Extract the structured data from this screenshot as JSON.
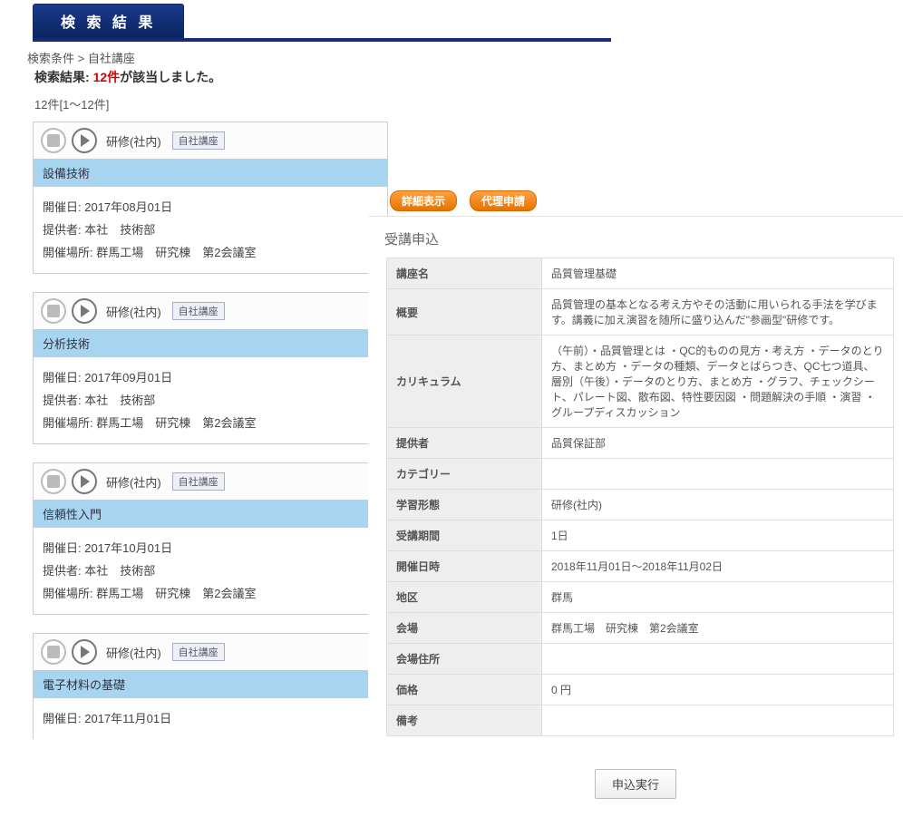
{
  "header": {
    "title": "検 索 結 果"
  },
  "breadcrumb": "検索条件 > 自社講座",
  "result": {
    "prefix": "検索結果: ",
    "count": "12件",
    "suffix": "が該当しました。"
  },
  "range": "12件[1～12件]",
  "buttons": {
    "detail": "詳細表示",
    "proxy": "代理申請",
    "apply": "申込実行"
  },
  "card_head": {
    "type_label": "研修(社内)",
    "tag": "自社講座"
  },
  "labels": {
    "date": "開催日: ",
    "provider": "提供者: ",
    "venue": "開催場所: "
  },
  "courses": [
    {
      "title": "設備技術",
      "date": "2017年08月01日",
      "provider": "本社　技術部",
      "venue": "群馬工場　研究棟　第2会議室"
    },
    {
      "title": "分析技術",
      "date": "2017年09月01日",
      "provider": "本社　技術部",
      "venue": "群馬工場　研究棟　第2会議室"
    },
    {
      "title": "信頼性入門",
      "date": "2017年10月01日",
      "provider": "本社　技術部",
      "venue": "群馬工場　研究棟　第2会議室"
    },
    {
      "title": "電子材料の基礎",
      "date": "2017年11月01日",
      "provider": "",
      "venue": ""
    }
  ],
  "panel": {
    "title": "受講申込",
    "rows": [
      {
        "label": "講座名",
        "value": "品質管理基礎"
      },
      {
        "label": "概要",
        "value": "品質管理の基本となる考え方やその活動に用いられる手法を学びます。講義に加え演習を随所に盛り込んだ\"参画型\"研修です。"
      },
      {
        "label": "カリキュラム",
        "value": "（午前）・品質管理とは ・QC的ものの見方・考え方 ・データのとり方、まとめ方 ・データの種類、データとばらつき、QC七つ道具、層別（午後）・データのとり方、まとめ方 ・グラフ、チェックシート、パレート図、散布図、特性要因図 ・問題解決の手順 ・演習 ・グループディスカッション"
      },
      {
        "label": "提供者",
        "value": "品質保証部"
      },
      {
        "label": "カテゴリー",
        "value": ""
      },
      {
        "label": "学習形態",
        "value": "研修(社内)"
      },
      {
        "label": "受講期間",
        "value": "1日"
      },
      {
        "label": "開催日時",
        "value": "2018年11月01日～2018年11月02日"
      },
      {
        "label": "地区",
        "value": "群馬"
      },
      {
        "label": "会場",
        "value": "群馬工場　研究棟　第2会議室"
      },
      {
        "label": "会場住所",
        "value": ""
      },
      {
        "label": "価格",
        "value": "0 円"
      },
      {
        "label": "備考",
        "value": ""
      }
    ]
  }
}
